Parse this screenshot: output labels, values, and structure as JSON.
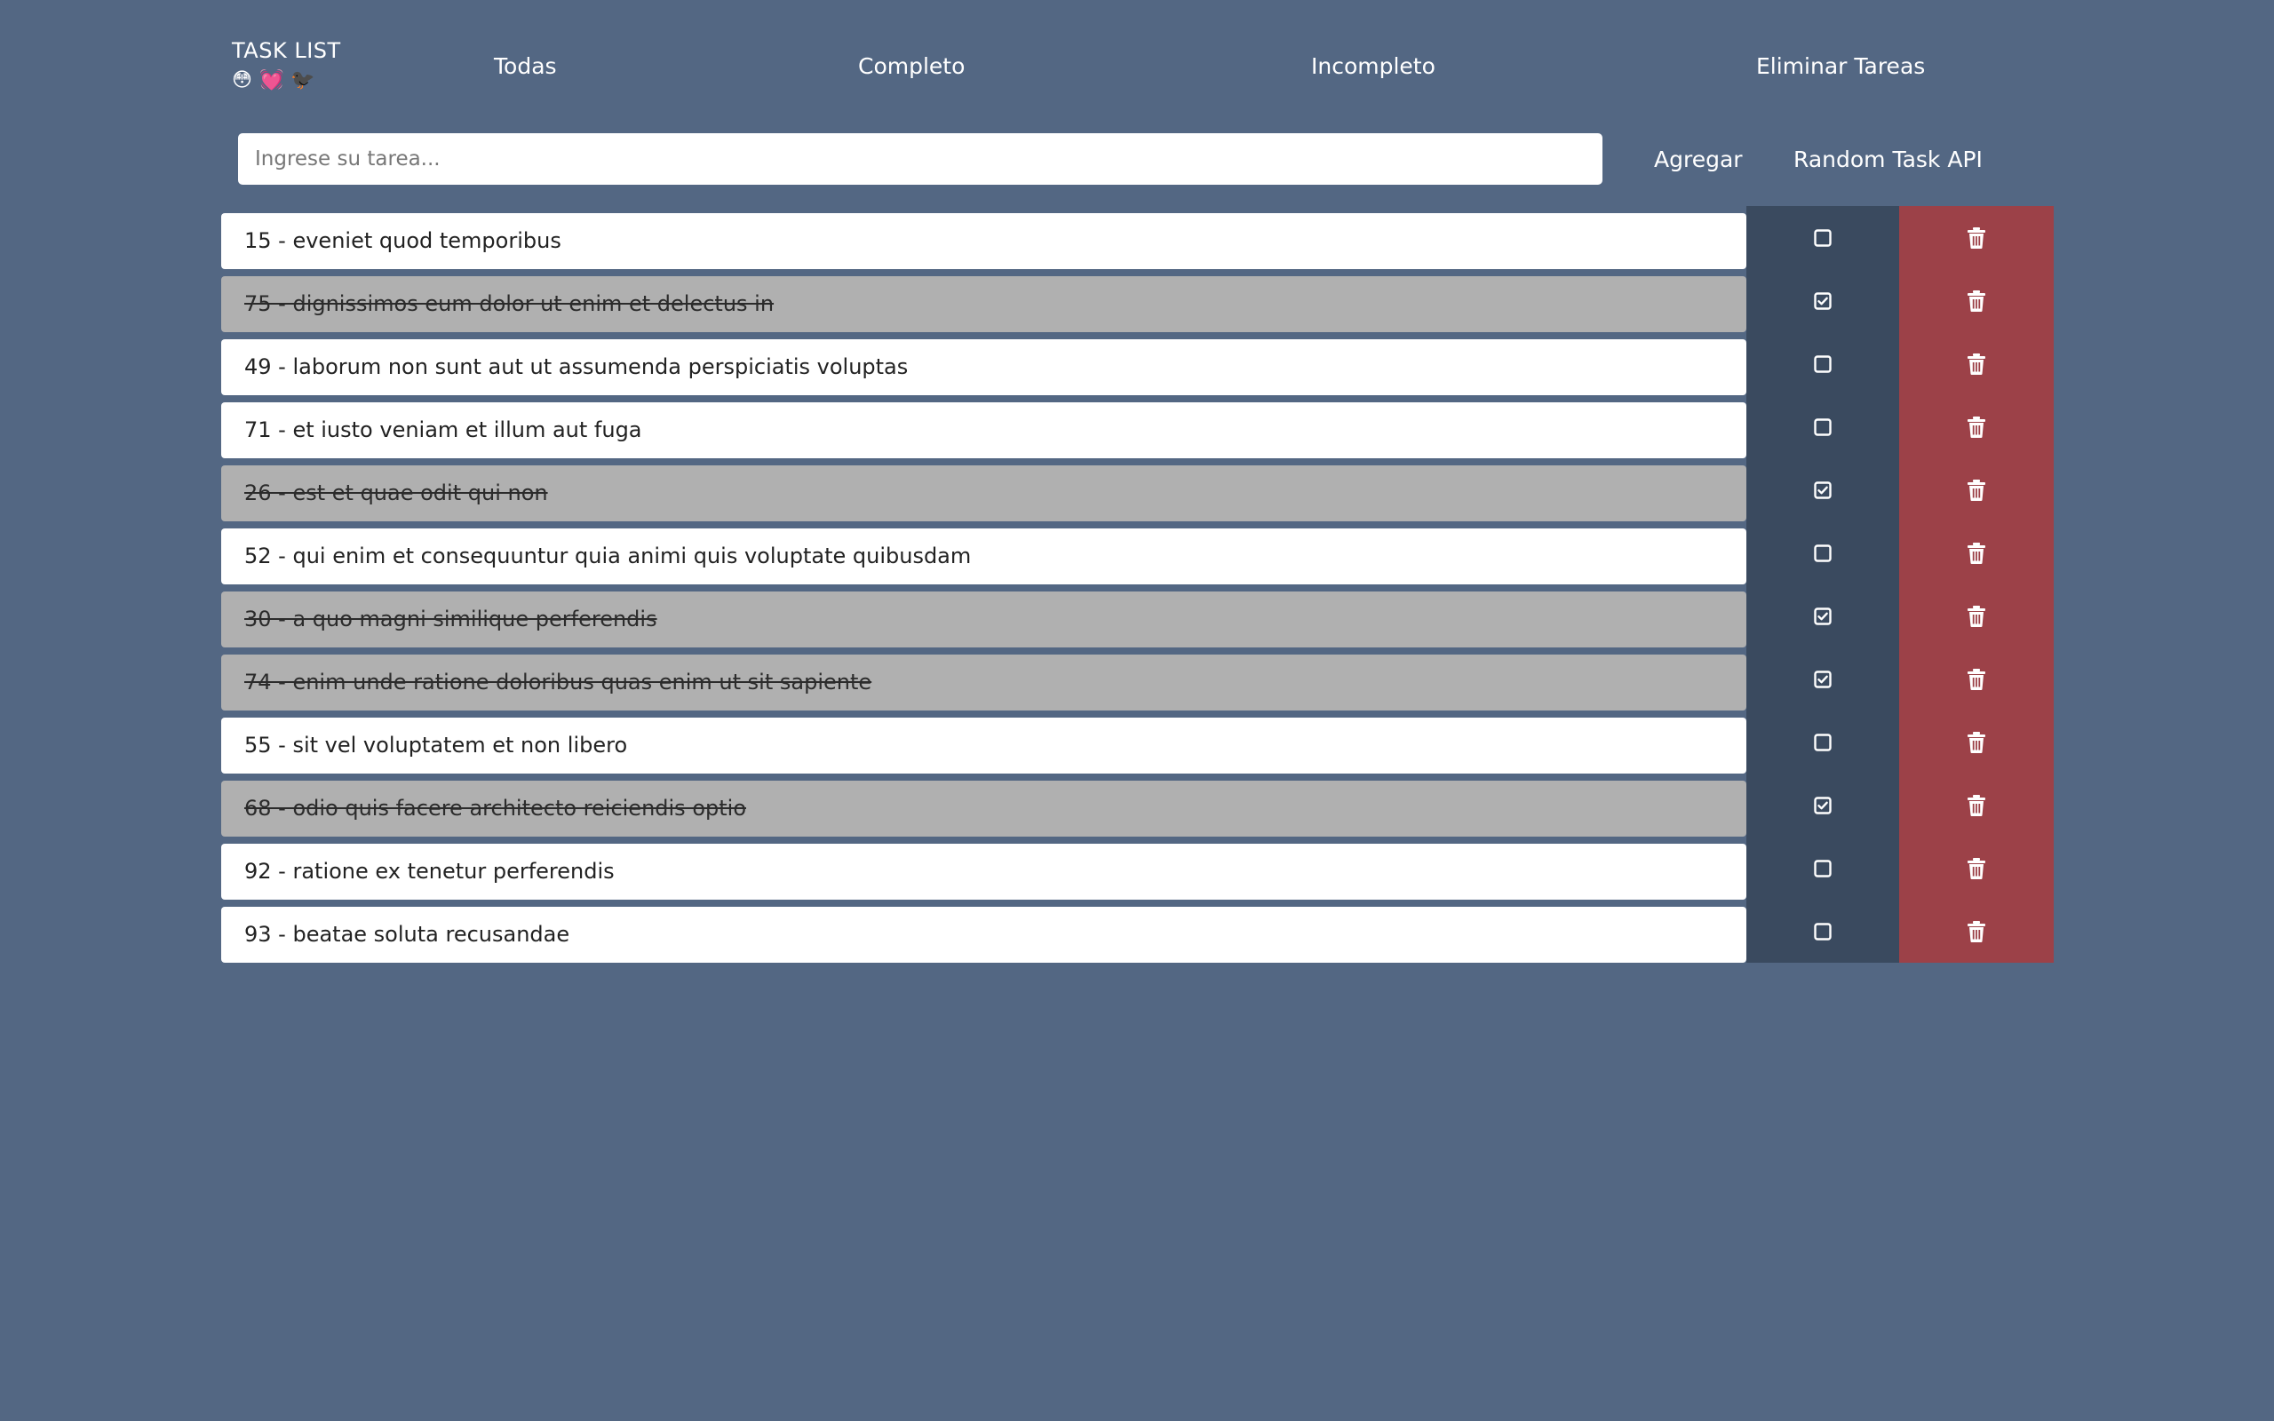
{
  "header": {
    "title": "TASK LIST",
    "emojis": [
      "😳",
      "💓",
      "🐦‍⬛"
    ],
    "nav": {
      "all": "Todas",
      "complete": "Completo",
      "incomplete": "Incompleto",
      "delete_tasks": "Eliminar Tareas"
    }
  },
  "input": {
    "placeholder": "Ingrese su tarea...",
    "value": ""
  },
  "actions": {
    "add": "Agregar",
    "random": "Random Task API"
  },
  "icons": {
    "check": "checkbox-icon",
    "delete": "trash-icon"
  },
  "colors": {
    "background": "#536783",
    "check_column": "#3a4a5f",
    "delete_column": "#9c4148",
    "done_row": "#b0b0b0"
  },
  "tasks": [
    {
      "text": "15 - eveniet quod temporibus",
      "done": false
    },
    {
      "text": "75 - dignissimos eum dolor ut enim et delectus in",
      "done": true
    },
    {
      "text": "49 - laborum non sunt aut ut assumenda perspiciatis voluptas",
      "done": false
    },
    {
      "text": "71 - et iusto veniam et illum aut fuga",
      "done": false
    },
    {
      "text": "26 - est et quae odit qui non",
      "done": true
    },
    {
      "text": "52 - qui enim et consequuntur quia animi quis voluptate quibusdam",
      "done": false
    },
    {
      "text": "30 - a quo magni similique perferendis",
      "done": true
    },
    {
      "text": "74 - enim unde ratione doloribus quas enim ut sit sapiente",
      "done": true
    },
    {
      "text": "55 - sit vel voluptatem et non libero",
      "done": false
    },
    {
      "text": "68 - odio quis facere architecto reiciendis optio",
      "done": true
    },
    {
      "text": "92 - ratione ex tenetur perferendis",
      "done": false
    },
    {
      "text": "93 - beatae soluta recusandae",
      "done": false
    }
  ]
}
